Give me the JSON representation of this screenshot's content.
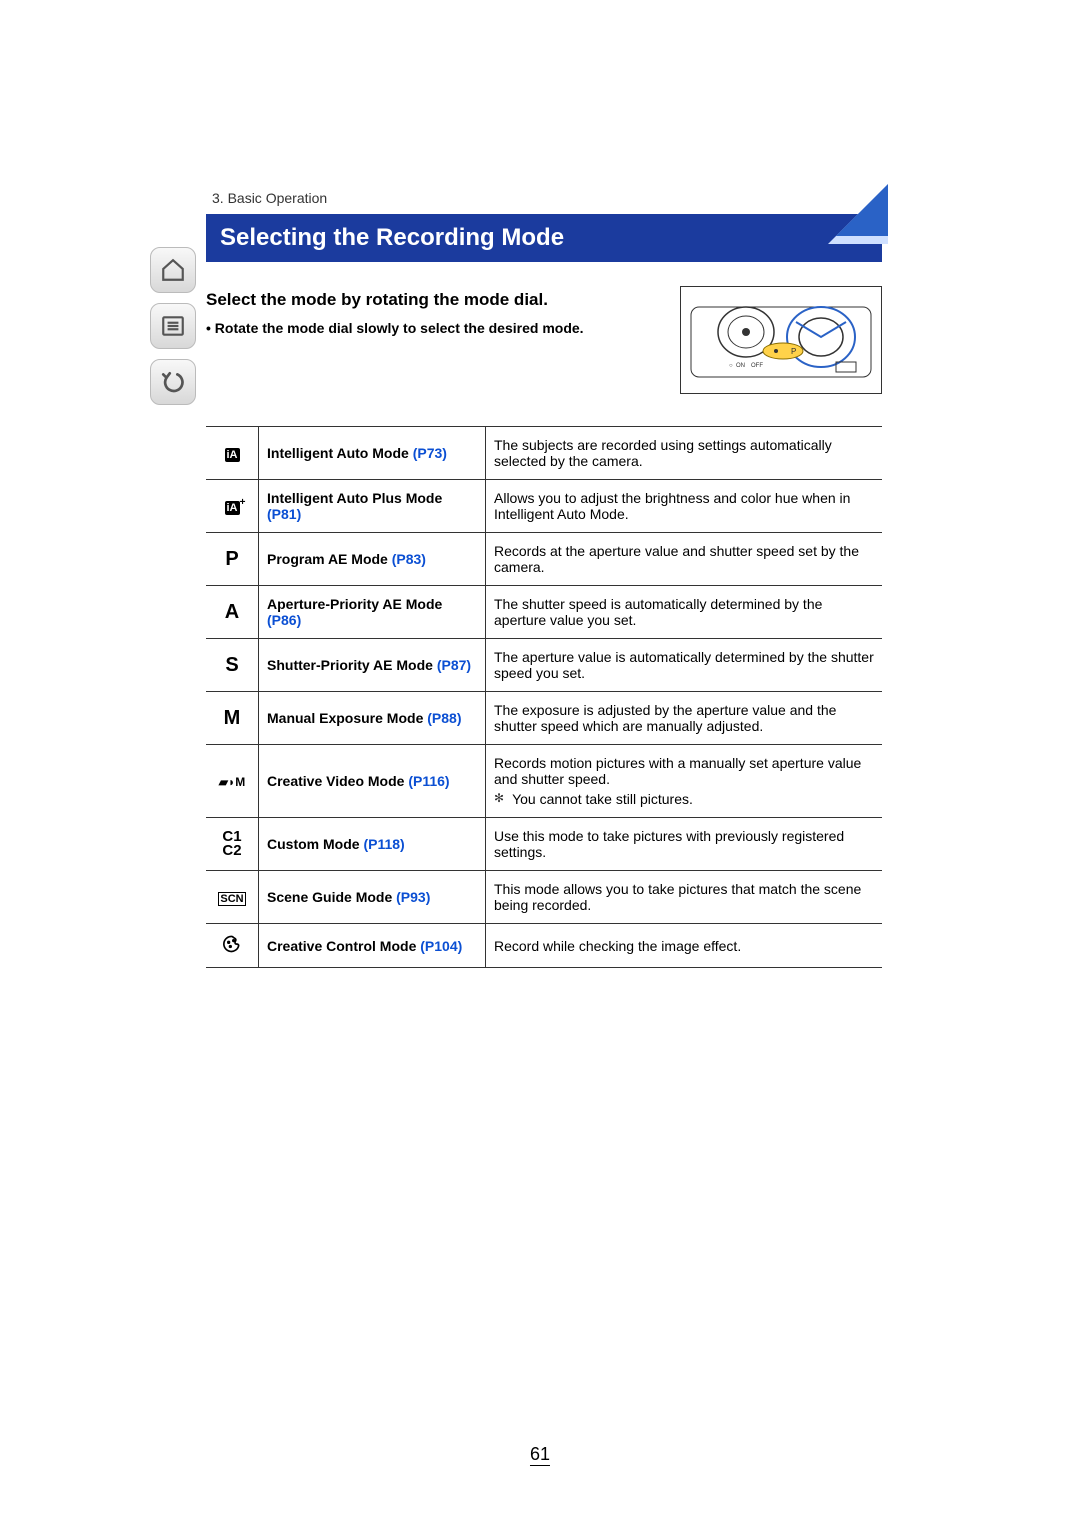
{
  "breadcrumb": "3. Basic Operation",
  "title": "Selecting the Recording Mode",
  "subhead": "Select the mode by rotating the mode dial.",
  "note": "Rotate the mode dial slowly to select the desired mode.",
  "page_number": "61",
  "diagram": {
    "on_label": "ON",
    "off_label": "OFF",
    "p_label": "P"
  },
  "modes": [
    {
      "icon": "iA",
      "name": "Intelligent Auto Mode",
      "pref": "(P73)",
      "desc": "The subjects are recorded using settings automatically selected by the camera."
    },
    {
      "icon": "iA+",
      "name": "Intelligent Auto Plus Mode",
      "pref": "(P81)",
      "desc": "Allows you to adjust the brightness and color hue when in Intelligent Auto Mode."
    },
    {
      "icon": "P",
      "name": "Program AE Mode",
      "pref": "(P83)",
      "desc": "Records at the aperture value and shutter speed set by the camera."
    },
    {
      "icon": "A",
      "name": "Aperture-Priority AE Mode",
      "pref": "(P86)",
      "desc": "The shutter speed is automatically determined by the aperture value you set."
    },
    {
      "icon": "S",
      "name": "Shutter-Priority AE Mode",
      "pref": "(P87)",
      "desc": "The aperture value is automatically determined by the shutter speed you set."
    },
    {
      "icon": "M",
      "name": "Manual Exposure Mode",
      "pref": "(P88)",
      "desc": "The exposure is adjusted by the aperture value and the shutter speed which are manually adjusted."
    },
    {
      "icon": "movie",
      "name": "Creative Video Mode",
      "pref": "(P116)",
      "desc": "Records motion pictures with a manually set aperture value and shutter speed.",
      "sub": "You cannot take still pictures."
    },
    {
      "icon": "C1C2",
      "name": "Custom Mode",
      "pref": "(P118)",
      "desc": "Use this mode to take pictures with previously registered settings."
    },
    {
      "icon": "SCN",
      "name": "Scene Guide Mode",
      "pref": "(P93)",
      "desc": "This mode allows you to take pictures that match the scene being recorded."
    },
    {
      "icon": "palette",
      "name": "Creative Control Mode",
      "pref": "(P104)",
      "desc": "Record while checking the image effect."
    }
  ]
}
